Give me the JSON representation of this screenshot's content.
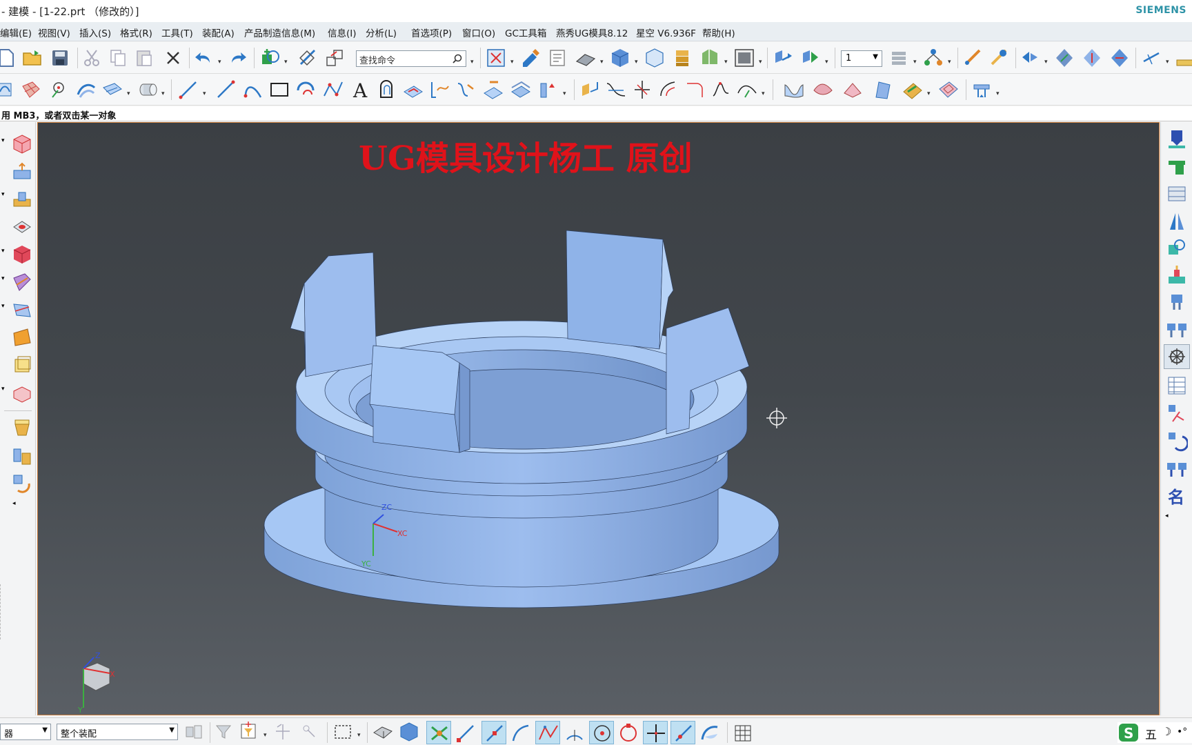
{
  "window": {
    "title": "- 建模 - [1-22.prt （修改的）]",
    "brand": "SIEMENS"
  },
  "menu": [
    {
      "label": "编辑(E)"
    },
    {
      "label": "视图(V)"
    },
    {
      "label": "插入(S)"
    },
    {
      "label": "格式(R)"
    },
    {
      "label": "工具(T)"
    },
    {
      "label": "装配(A)"
    },
    {
      "label": "产品制造信息(M)"
    },
    {
      "label": "信息(I)"
    },
    {
      "label": "分析(L)"
    },
    {
      "label": "首选项(P)"
    },
    {
      "label": "窗口(O)"
    },
    {
      "label": "GC工具箱"
    },
    {
      "label": "燕秀UG模具8.12"
    },
    {
      "label": "星空 V6.936F"
    },
    {
      "label": "帮助(H)"
    }
  ],
  "toolbar": {
    "find_placeholder": "查找命令",
    "layer_value": "1"
  },
  "cue": {
    "text": "用 MB3，或者双击某一对象"
  },
  "viewport": {
    "watermark": "UG模具设计杨工 原创",
    "wcs_labels": {
      "z": "ZC",
      "x": "XC",
      "y": "YC"
    },
    "triad_labels": {
      "z": "Z",
      "x": "X",
      "y": "Y"
    }
  },
  "status": {
    "filter_value": "器",
    "scope_value": "整个装配",
    "ime_label": "五"
  },
  "colors": {
    "part_fill": "#8fb3e8",
    "part_light": "#b7d3f7",
    "part_dark": "#6f93c8",
    "watermark": "#e0121a",
    "brand": "#2e93a7"
  }
}
